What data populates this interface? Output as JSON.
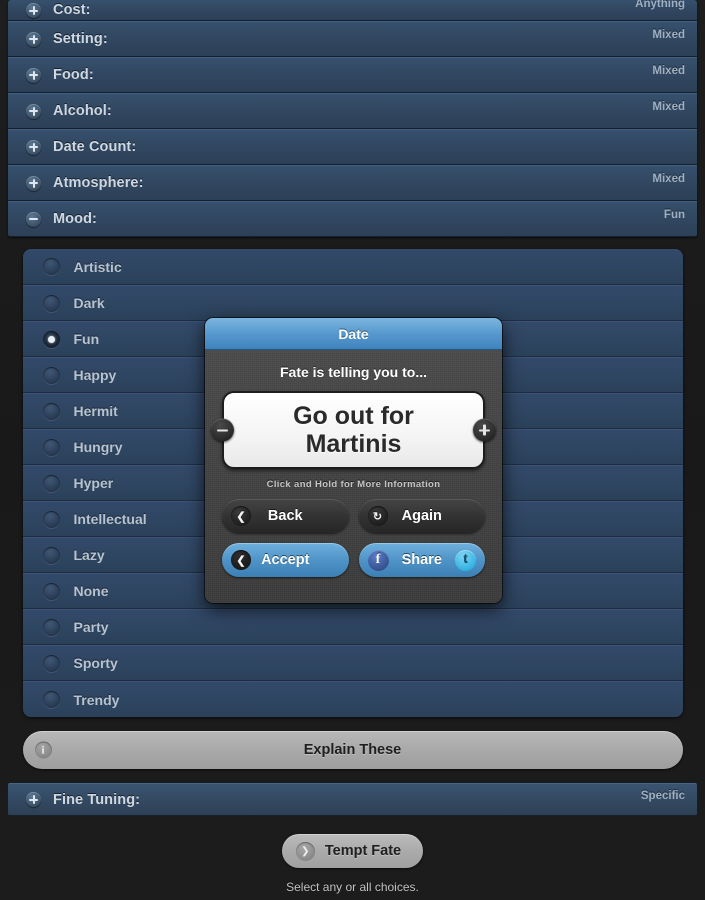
{
  "accordion": {
    "rows": [
      {
        "label": "Cost:",
        "value": "Anything",
        "expanded": false,
        "partial": true
      },
      {
        "label": "Setting:",
        "value": "Mixed",
        "expanded": false,
        "partial": false
      },
      {
        "label": "Food:",
        "value": "Mixed",
        "expanded": false,
        "partial": false
      },
      {
        "label": "Alcohol:",
        "value": "Mixed",
        "expanded": false,
        "partial": false
      },
      {
        "label": "Date Count:",
        "value": "",
        "expanded": false,
        "partial": false
      },
      {
        "label": "Atmosphere:",
        "value": "Mixed",
        "expanded": false,
        "partial": false
      },
      {
        "label": "Mood:",
        "value": "Fun",
        "expanded": true,
        "partial": false
      }
    ]
  },
  "options": {
    "items": [
      {
        "label": "Artistic",
        "checked": false
      },
      {
        "label": "Dark",
        "checked": false
      },
      {
        "label": "Fun",
        "checked": true
      },
      {
        "label": "Happy",
        "checked": false
      },
      {
        "label": "Hermit",
        "checked": false
      },
      {
        "label": "Hungry",
        "checked": false
      },
      {
        "label": "Hyper",
        "checked": false
      },
      {
        "label": "Intellectual",
        "checked": false
      },
      {
        "label": "Lazy",
        "checked": false
      },
      {
        "label": "None",
        "checked": false
      },
      {
        "label": "Party",
        "checked": false
      },
      {
        "label": "Sporty",
        "checked": false
      },
      {
        "label": "Trendy",
        "checked": false
      }
    ]
  },
  "explain": {
    "label": "Explain These",
    "icon": "info-icon",
    "icon_glyph": "i"
  },
  "fine_tuning": {
    "label": "Fine Tuning:",
    "value": "Specific"
  },
  "tempt": {
    "label": "Tempt Fate",
    "icon": "chevron-right-icon",
    "icon_glyph": "❯"
  },
  "hint": "Select any or all choices.",
  "modal": {
    "title": "Date",
    "subtitle": "Fate is telling you to...",
    "card_text": "Go out for Martinis",
    "hold_hint": "Click and Hold for More Information",
    "stepper_minus": "−",
    "stepper_plus": "+",
    "buttons": {
      "back": {
        "label": "Back",
        "icon": "chevron-left-icon",
        "icon_glyph": "❮"
      },
      "again": {
        "label": "Again",
        "icon": "refresh-icon",
        "icon_glyph": "↻"
      },
      "accept": {
        "label": "Accept",
        "icon": "chevron-left-icon",
        "icon_glyph": "❮"
      },
      "share": {
        "label": "Share",
        "facebook_icon": "facebook-icon",
        "facebook_glyph": "f",
        "twitter_icon": "twitter-icon",
        "twitter_glyph": "t"
      }
    }
  },
  "colors": {
    "page_background": "#1c1c1c",
    "accordion_blue": "#31465f",
    "option_blue": "#2e4560",
    "modal_title_blue": "#5a9bd0",
    "modal_body_gray": "#424242",
    "accent_button_blue": "#4f94c8",
    "gray_button": "#a9a9a9",
    "facebook_blue": "#3b5998",
    "twitter_blue": "#3fb8e5"
  }
}
